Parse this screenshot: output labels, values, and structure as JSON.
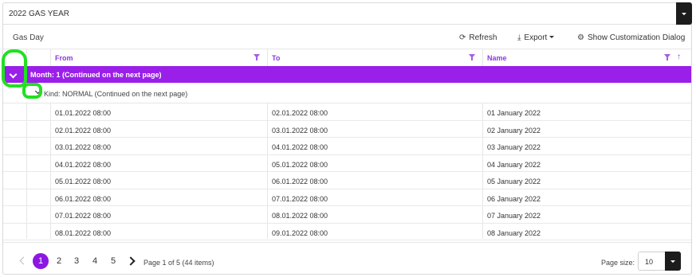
{
  "year_select": {
    "value": "2022 GAS YEAR"
  },
  "toolbar": {
    "group_label": "Gas Day",
    "refresh": "Refresh",
    "export": "Export",
    "customize": "Show Customization Dialog"
  },
  "columns": [
    {
      "label": "From",
      "filter_icon": "filter-icon"
    },
    {
      "label": "To",
      "filter_icon": "filter-icon"
    },
    {
      "label": "Name",
      "filter_icon": "filter-icon",
      "sort_icon": "sort-ascending-icon"
    }
  ],
  "group": {
    "label": "Month: 1 (Continued on the next page)",
    "subgroup_label": "Kind: NORMAL (Continued on the next page)"
  },
  "rows": [
    {
      "from": "01.01.2022 08:00",
      "to": "02.01.2022 08:00",
      "name": "01 January 2022"
    },
    {
      "from": "02.01.2022 08:00",
      "to": "03.01.2022 08:00",
      "name": "02 January 2022"
    },
    {
      "from": "03.01.2022 08:00",
      "to": "04.01.2022 08:00",
      "name": "03 January 2022"
    },
    {
      "from": "04.01.2022 08:00",
      "to": "05.01.2022 08:00",
      "name": "04 January 2022"
    },
    {
      "from": "05.01.2022 08:00",
      "to": "06.01.2022 08:00",
      "name": "05 January 2022"
    },
    {
      "from": "06.01.2022 08:00",
      "to": "07.01.2022 08:00",
      "name": "06 January 2022"
    },
    {
      "from": "07.01.2022 08:00",
      "to": "08.01.2022 08:00",
      "name": "07 January 2022"
    },
    {
      "from": "08.01.2022 08:00",
      "to": "09.01.2022 08:00",
      "name": "08 January 2022"
    }
  ],
  "pager": {
    "pages": [
      "1",
      "2",
      "3",
      "4",
      "5"
    ],
    "current_page": "1",
    "info": "Page 1 of 5 (44 items)",
    "page_size_label": "Page size:",
    "page_size": "10"
  },
  "colors": {
    "accent": "#8d17e2",
    "group_row": "#9a1fe8",
    "highlight": "#22e022"
  }
}
